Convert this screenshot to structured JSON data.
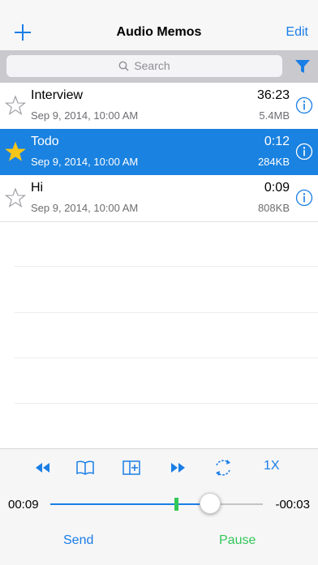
{
  "navbar": {
    "title": "Audio Memos",
    "edit_label": "Edit",
    "add_icon": "plus-icon"
  },
  "search": {
    "placeholder": "Search",
    "filter_icon": "filter-icon"
  },
  "memos": [
    {
      "title": "Interview",
      "date": "Sep 9, 2014, 10:00 AM",
      "duration": "36:23",
      "size": "5.4MB",
      "starred": false,
      "selected": false
    },
    {
      "title": "Todo",
      "date": "Sep 9, 2014, 10:00 AM",
      "duration": "0:12",
      "size": "284KB",
      "starred": true,
      "selected": true
    },
    {
      "title": "Hi",
      "date": "Sep 9, 2014, 10:00 AM",
      "duration": "0:09",
      "size": "808KB",
      "starred": false,
      "selected": false
    }
  ],
  "player": {
    "controls": [
      "rewind-icon",
      "bookmarks-icon",
      "add-bookmark-icon",
      "fast-forward-icon",
      "repeat-icon"
    ],
    "speed_label": "1X",
    "elapsed": "00:09",
    "remaining": "-00:03",
    "progress": 0.75,
    "marker_position": 0.59,
    "send_label": "Send",
    "pause_label": "Pause"
  },
  "colors": {
    "accent": "#1a7ee6",
    "selected_row": "#1a82e0",
    "pause": "#34c759",
    "star_filled": "#f5c518"
  }
}
